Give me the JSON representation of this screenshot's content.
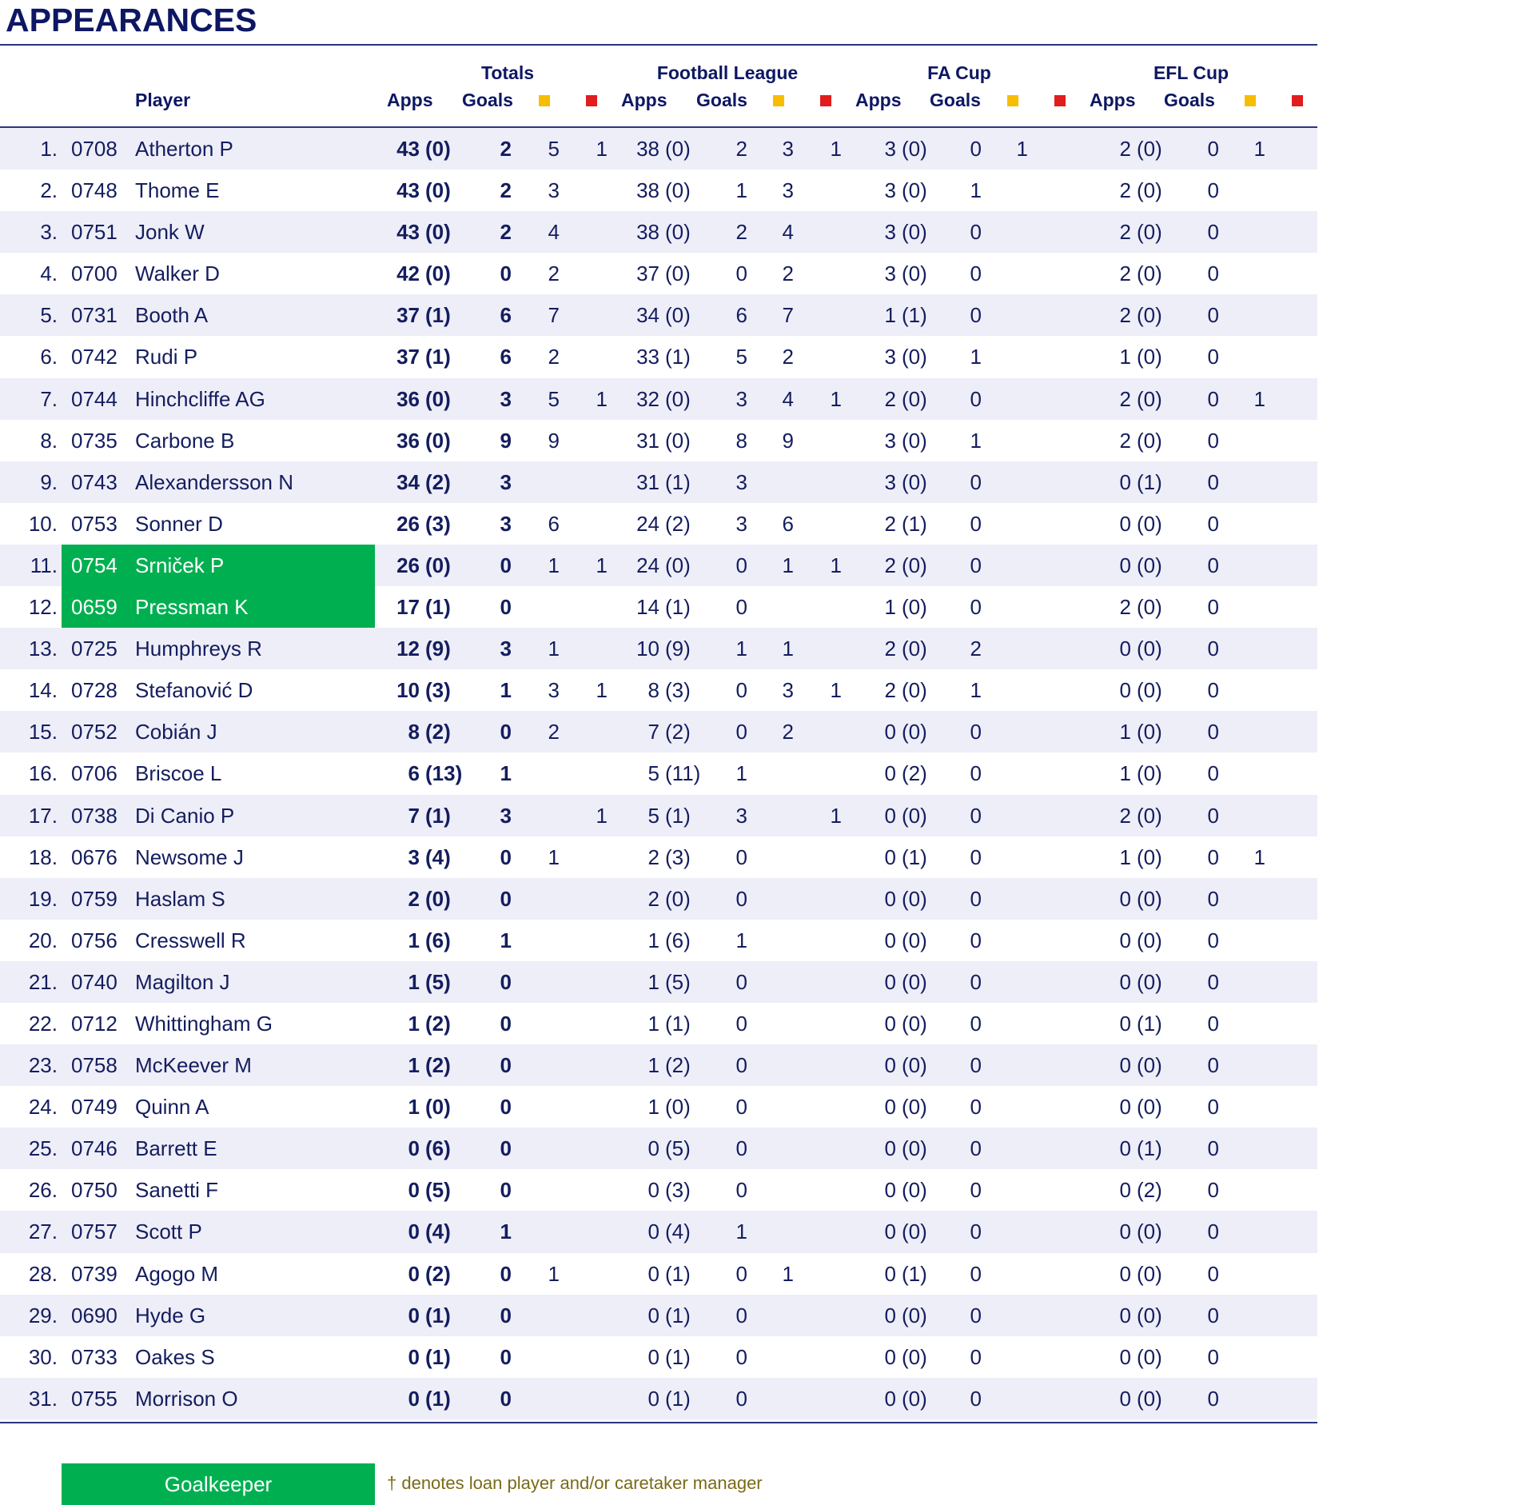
{
  "title": "APPEARANCES",
  "header": {
    "player": "Player",
    "groups": [
      "Totals",
      "Football League",
      "FA Cup",
      "EFL Cup"
    ],
    "apps": "Apps",
    "goals": "Goals"
  },
  "colors": {
    "heading": "#0d1763",
    "goalkeeper": "#00b050",
    "yellow_card": "#f7bd00",
    "red_card": "#e21d1d",
    "alt_row": "#eeeef8",
    "note": "#7a6a16"
  },
  "columns": [
    "num",
    "id",
    "name",
    "tot_apps",
    "tot_goals",
    "tot_y",
    "tot_r",
    "fl_apps",
    "fl_goals",
    "fl_y",
    "fl_r",
    "fa_apps",
    "fa_goals",
    "fa_y",
    "fa_r",
    "efl_apps",
    "efl_goals",
    "efl_y",
    "efl_r"
  ],
  "players": [
    [
      "1.",
      "0708",
      "Atherton P",
      "43 (0)",
      "2",
      "5",
      "1",
      "38 (0)",
      "2",
      "3",
      "1",
      "3 (0)",
      "0",
      "1",
      "",
      "2 (0)",
      "0",
      "1",
      ""
    ],
    [
      "2.",
      "0748",
      "Thome E",
      "43 (0)",
      "2",
      "3",
      "",
      "38 (0)",
      "1",
      "3",
      "",
      "3 (0)",
      "1",
      "",
      "",
      "2 (0)",
      "0",
      "",
      ""
    ],
    [
      "3.",
      "0751",
      "Jonk W",
      "43 (0)",
      "2",
      "4",
      "",
      "38 (0)",
      "2",
      "4",
      "",
      "3 (0)",
      "0",
      "",
      "",
      "2 (0)",
      "0",
      "",
      ""
    ],
    [
      "4.",
      "0700",
      "Walker D",
      "42 (0)",
      "0",
      "2",
      "",
      "37 (0)",
      "0",
      "2",
      "",
      "3 (0)",
      "0",
      "",
      "",
      "2 (0)",
      "0",
      "",
      ""
    ],
    [
      "5.",
      "0731",
      "Booth A",
      "37 (1)",
      "6",
      "7",
      "",
      "34 (0)",
      "6",
      "7",
      "",
      "1 (1)",
      "0",
      "",
      "",
      "2 (0)",
      "0",
      "",
      ""
    ],
    [
      "6.",
      "0742",
      "Rudi P",
      "37 (1)",
      "6",
      "2",
      "",
      "33 (1)",
      "5",
      "2",
      "",
      "3 (0)",
      "1",
      "",
      "",
      "1 (0)",
      "0",
      "",
      ""
    ],
    [
      "7.",
      "0744",
      "Hinchcliffe AG",
      "36 (0)",
      "3",
      "5",
      "1",
      "32 (0)",
      "3",
      "4",
      "1",
      "2 (0)",
      "0",
      "",
      "",
      "2 (0)",
      "0",
      "1",
      ""
    ],
    [
      "8.",
      "0735",
      "Carbone B",
      "36 (0)",
      "9",
      "9",
      "",
      "31 (0)",
      "8",
      "9",
      "",
      "3 (0)",
      "1",
      "",
      "",
      "2 (0)",
      "0",
      "",
      ""
    ],
    [
      "9.",
      "0743",
      "Alexandersson N",
      "34 (2)",
      "3",
      "",
      "",
      "31 (1)",
      "3",
      "",
      "",
      "3 (0)",
      "0",
      "",
      "",
      "0 (1)",
      "0",
      "",
      ""
    ],
    [
      "10.",
      "0753",
      "Sonner D",
      "26 (3)",
      "3",
      "6",
      "",
      "24 (2)",
      "3",
      "6",
      "",
      "2 (1)",
      "0",
      "",
      "",
      "0 (0)",
      "0",
      "",
      ""
    ],
    [
      "11.",
      "0754",
      "Srniček P",
      "26 (0)",
      "0",
      "1",
      "1",
      "24 (0)",
      "0",
      "1",
      "1",
      "2 (0)",
      "0",
      "",
      "",
      "0 (0)",
      "0",
      "",
      ""
    ],
    [
      "12.",
      "0659",
      "Pressman K",
      "17 (1)",
      "0",
      "",
      "",
      "14 (1)",
      "0",
      "",
      "",
      "1 (0)",
      "0",
      "",
      "",
      "2 (0)",
      "0",
      "",
      ""
    ],
    [
      "13.",
      "0725",
      "Humphreys R",
      "12 (9)",
      "3",
      "1",
      "",
      "10 (9)",
      "1",
      "1",
      "",
      "2 (0)",
      "2",
      "",
      "",
      "0 (0)",
      "0",
      "",
      ""
    ],
    [
      "14.",
      "0728",
      "Stefanović D",
      "10 (3)",
      "1",
      "3",
      "1",
      "8 (3)",
      "0",
      "3",
      "1",
      "2 (0)",
      "1",
      "",
      "",
      "0 (0)",
      "0",
      "",
      ""
    ],
    [
      "15.",
      "0752",
      "Cobián J",
      "8 (2)",
      "0",
      "2",
      "",
      "7 (2)",
      "0",
      "2",
      "",
      "0 (0)",
      "0",
      "",
      "",
      "1 (0)",
      "0",
      "",
      ""
    ],
    [
      "16.",
      "0706",
      "Briscoe L",
      "6 (13)",
      "1",
      "",
      "",
      "5 (11)",
      "1",
      "",
      "",
      "0 (2)",
      "0",
      "",
      "",
      "1 (0)",
      "0",
      "",
      ""
    ],
    [
      "17.",
      "0738",
      "Di Canio P",
      "7 (1)",
      "3",
      "",
      "1",
      "5 (1)",
      "3",
      "",
      "1",
      "0 (0)",
      "0",
      "",
      "",
      "2 (0)",
      "0",
      "",
      ""
    ],
    [
      "18.",
      "0676",
      "Newsome J",
      "3 (4)",
      "0",
      "1",
      "",
      "2 (3)",
      "0",
      "",
      "",
      "0 (1)",
      "0",
      "",
      "",
      "1 (0)",
      "0",
      "1",
      ""
    ],
    [
      "19.",
      "0759",
      "Haslam S",
      "2 (0)",
      "0",
      "",
      "",
      "2 (0)",
      "0",
      "",
      "",
      "0 (0)",
      "0",
      "",
      "",
      "0 (0)",
      "0",
      "",
      ""
    ],
    [
      "20.",
      "0756",
      "Cresswell R",
      "1 (6)",
      "1",
      "",
      "",
      "1 (6)",
      "1",
      "",
      "",
      "0 (0)",
      "0",
      "",
      "",
      "0 (0)",
      "0",
      "",
      ""
    ],
    [
      "21.",
      "0740",
      "Magilton J",
      "1 (5)",
      "0",
      "",
      "",
      "1 (5)",
      "0",
      "",
      "",
      "0 (0)",
      "0",
      "",
      "",
      "0 (0)",
      "0",
      "",
      ""
    ],
    [
      "22.",
      "0712",
      "Whittingham G",
      "1 (2)",
      "0",
      "",
      "",
      "1 (1)",
      "0",
      "",
      "",
      "0 (0)",
      "0",
      "",
      "",
      "0 (1)",
      "0",
      "",
      ""
    ],
    [
      "23.",
      "0758",
      "McKeever M",
      "1 (2)",
      "0",
      "",
      "",
      "1 (2)",
      "0",
      "",
      "",
      "0 (0)",
      "0",
      "",
      "",
      "0 (0)",
      "0",
      "",
      ""
    ],
    [
      "24.",
      "0749",
      "Quinn A",
      "1 (0)",
      "0",
      "",
      "",
      "1 (0)",
      "0",
      "",
      "",
      "0 (0)",
      "0",
      "",
      "",
      "0 (0)",
      "0",
      "",
      ""
    ],
    [
      "25.",
      "0746",
      "Barrett E",
      "0 (6)",
      "0",
      "",
      "",
      "0 (5)",
      "0",
      "",
      "",
      "0 (0)",
      "0",
      "",
      "",
      "0 (1)",
      "0",
      "",
      ""
    ],
    [
      "26.",
      "0750",
      "Sanetti F",
      "0 (5)",
      "0",
      "",
      "",
      "0 (3)",
      "0",
      "",
      "",
      "0 (0)",
      "0",
      "",
      "",
      "0 (2)",
      "0",
      "",
      ""
    ],
    [
      "27.",
      "0757",
      "Scott P",
      "0 (4)",
      "1",
      "",
      "",
      "0 (4)",
      "1",
      "",
      "",
      "0 (0)",
      "0",
      "",
      "",
      "0 (0)",
      "0",
      "",
      ""
    ],
    [
      "28.",
      "0739",
      "Agogo M",
      "0 (2)",
      "0",
      "1",
      "",
      "0 (1)",
      "0",
      "1",
      "",
      "0 (1)",
      "0",
      "",
      "",
      "0 (0)",
      "0",
      "",
      ""
    ],
    [
      "29.",
      "0690",
      "Hyde G",
      "0 (1)",
      "0",
      "",
      "",
      "0 (1)",
      "0",
      "",
      "",
      "0 (0)",
      "0",
      "",
      "",
      "0 (0)",
      "0",
      "",
      ""
    ],
    [
      "30.",
      "0733",
      "Oakes S",
      "0 (1)",
      "0",
      "",
      "",
      "0 (1)",
      "0",
      "",
      "",
      "0 (0)",
      "0",
      "",
      "",
      "0 (0)",
      "0",
      "",
      ""
    ],
    [
      "31.",
      "0755",
      "Morrison O",
      "0 (1)",
      "0",
      "",
      "",
      "0 (1)",
      "0",
      "",
      "",
      "0 (0)",
      "0",
      "",
      "",
      "0 (0)",
      "0",
      "",
      ""
    ]
  ],
  "goalkeeper_rows": [
    11,
    12
  ],
  "legend": {
    "goalkeeper": "Goalkeeper",
    "note": "† denotes loan player and/or caretaker manager"
  }
}
